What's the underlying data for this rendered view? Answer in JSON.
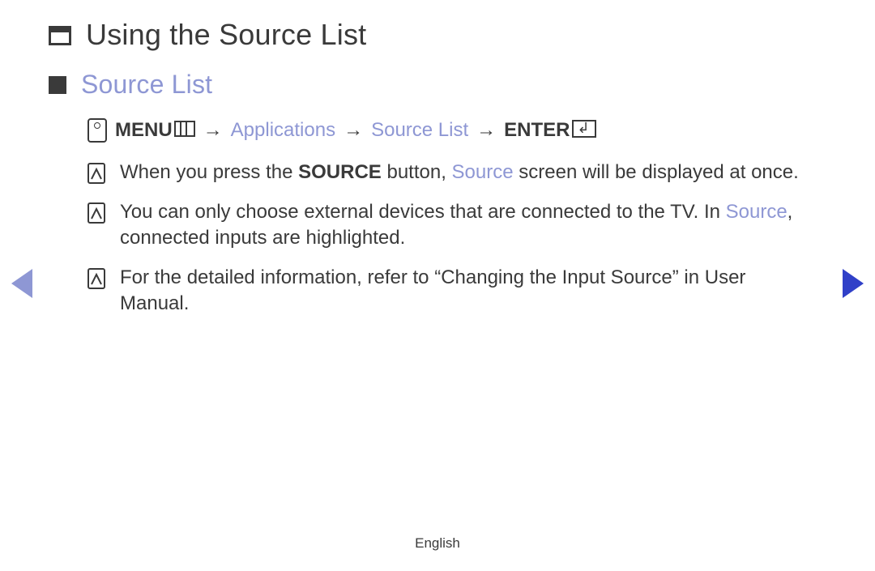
{
  "title": "Using the Source List",
  "subtitle": "Source List",
  "nav": {
    "menu_label": "MENU",
    "path1": "Applications",
    "path2": "Source List",
    "enter_label": "ENTER",
    "sep": "→"
  },
  "notes": [
    {
      "pre": "When you press the ",
      "bold": "SOURCE",
      "mid": " button, ",
      "accent": "Source",
      "post": " screen will be displayed at once."
    },
    {
      "pre": "You can only choose external devices that are connected to the TV. In ",
      "accent": "Source",
      "post": ", connected inputs are highlighted."
    },
    {
      "pre": "For the detailed information, refer to “Changing the Input Source” in User Manual."
    }
  ],
  "footer": {
    "language": "English"
  }
}
